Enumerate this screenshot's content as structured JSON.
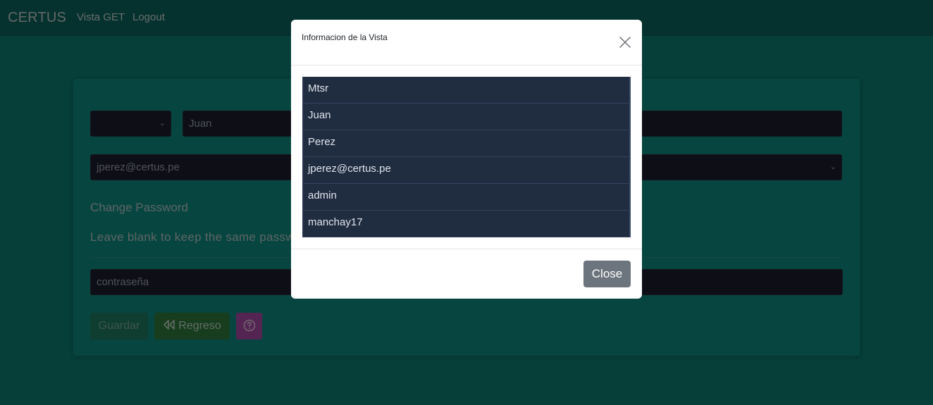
{
  "navbar": {
    "brand": "CERTUS",
    "links": [
      "Vista GET",
      "Logout"
    ]
  },
  "form": {
    "name_value": "Juan",
    "email_value": "jperez@certus.pe",
    "change_password_label": "Change Password",
    "leave_blank_label": "Leave blank to keep the same password",
    "password_placeholder": "contraseña",
    "guardar_label": "Guardar",
    "regreso_label": "Regreso",
    "help_icon": "question-circle-icon",
    "rewind_icon": "rewind-icon"
  },
  "modal": {
    "title": "Informacion de la Vista",
    "items": [
      "Mtsr",
      "Juan",
      "Perez",
      "jperez@certus.pe",
      "admin",
      "manchay17"
    ],
    "close_label": "Close"
  },
  "colors": {
    "page_bg": "#0c7c72",
    "list_item_bg": "#202c40",
    "close_button": "#6c757d",
    "help_button": "#a94aa6",
    "regreso_button": "#2e7a3c"
  }
}
